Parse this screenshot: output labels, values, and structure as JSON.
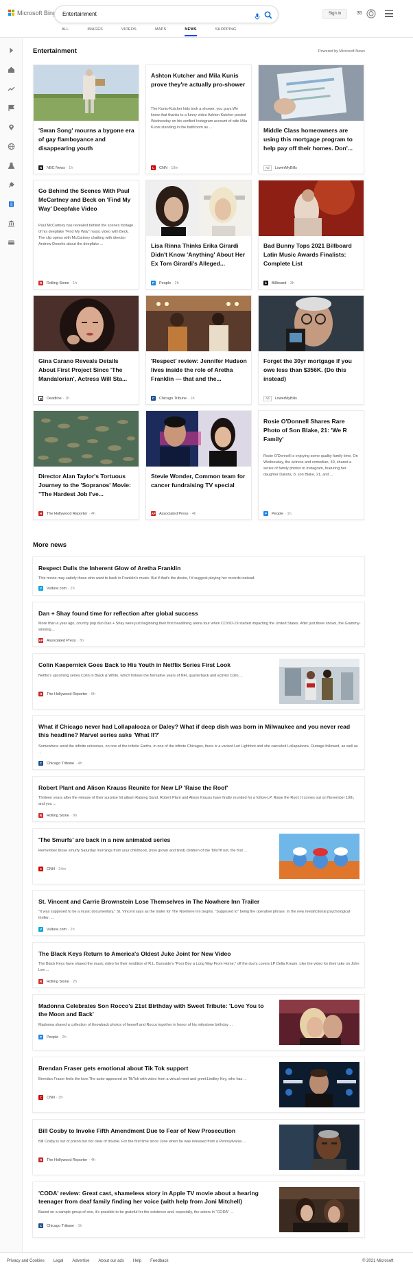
{
  "header": {
    "brand": "Microsoft Bing",
    "query": "Entertainment",
    "sign_in": "Sign in",
    "points": "35",
    "tabs": [
      {
        "label": "ALL"
      },
      {
        "label": "IMAGES"
      },
      {
        "label": "VIDEOS"
      },
      {
        "label": "MAPS"
      },
      {
        "label": "NEWS",
        "active": true
      },
      {
        "label": "SHOPPING"
      }
    ]
  },
  "section": {
    "title": "Entertainment",
    "powered": "Powered by Microsoft News"
  },
  "cards": [
    {
      "title": "'Swan Song' mourns a bygone era of gay flamboyance and disappearing youth",
      "source": "NBC News",
      "time": "1h",
      "icon": "nbc-peacock-icon"
    },
    {
      "title": "Ashton Kutcher and Mila Kunis prove they're actually pro-shower",
      "snippet": "The Kunis-Kutcher kids took a shower, you guys.We know that thanks to a funny video Ashton Kutcher posted Wednesday on his verified Instagram account of wife Mila Kunis standing in the bathroom as ...",
      "source": "CNN",
      "time": "18m",
      "icon": "cnn-icon"
    },
    {
      "title": "Middle Class homeowners are using this mortgage program to help pay off their homes. Don'...",
      "ad": "Ad",
      "source": "LowerMyBills",
      "icon": ""
    },
    {
      "title": "Go Behind the Scenes With Paul McCartney and Beck on 'Find My Way' Deepfake Video",
      "snippet": "Paul McCartney has revealed behind the scenes footage of his deepfake \"Find My Way\" music video with Beck. The clip opens with McCartney chatting with director Andrew Donoho about the deepfake ...",
      "source": "Rolling Stone",
      "time": "1h",
      "icon": "rolling-stone-icon"
    },
    {
      "title": "Lisa Rinna Thinks Erika Girardi Didn't Know 'Anything' About Her Ex Tom Girardi's Alleged...",
      "source": "People",
      "time": "2h",
      "icon": "people-icon"
    },
    {
      "title": "Bad Bunny Tops 2021 Billboard Latin Music Awards Finalists: Complete List",
      "source": "Billboard",
      "time": "3h",
      "icon": "billboard-icon"
    },
    {
      "title": "Gina Carano Reveals Details About First Project Since 'The Mandalorian', Actress Will Sta...",
      "source": "Deadline",
      "time": "1h",
      "icon": "deadline-icon"
    },
    {
      "title": "'Respect' review: Jennifer Hudson lives inside the role of Aretha Franklin — that and the...",
      "source": "Chicago Tribune",
      "time": "1h",
      "icon": "chicago-tribune-icon"
    },
    {
      "title": "Forget the 30yr mortgage if you owe less than $356K. (Do this instead)",
      "ad": "Ad",
      "source": "LowerMyBills",
      "icon": ""
    },
    {
      "title": "Director Alan Taylor's Tortuous Journey to the 'Sopranos' Movie: \"The Hardest Job I've...",
      "source": "The Hollywood Reporter",
      "time": "4h",
      "icon": "hollywood-reporter-icon"
    },
    {
      "title": "Stevie Wonder, Common team for cancer fundraising TV special",
      "source": "Associated Press",
      "time": "4h",
      "icon": "ap-icon"
    },
    {
      "title": "Rosie O'Donnell Shares Rare Photo of Son Blake, 21: 'We R Family'",
      "snippet": "Rosie O'Donnell is enjoying some quality family time. On Wednesday, the actress and comedian, 59, shared a series of family photos to Instagram, featuring her daughter Dakota, 8, son Blake, 21, and ...",
      "source": "People",
      "time": "1h",
      "icon": "people-icon"
    }
  ],
  "more_news": {
    "title": "More news",
    "items": [
      {
        "title": "Respect Dulls the Inherent Glow of Aretha Franklin",
        "snippet": "This movie may satisfy those who want to bask in Franklin's music. But if that's the desire, I'd suggest playing her records instead.",
        "source": "Vulture.com",
        "time": "2h",
        "icon": "vulture-icon"
      },
      {
        "title": "Dan + Shay found time for reflection after global success",
        "snippet": "More than a year ago, country pop duo Dan + Shay were just beginning their first headlining arena tour when COVID-19 started impacting the United States. After just three shows, the Grammy-winning ...",
        "source": "Associated Press",
        "time": "3h",
        "icon": "ap-icon"
      },
      {
        "title": "Colin Kaepernick Goes Back to His Youth in Netflix Series First Look",
        "snippet": "Netflix's upcoming series Colin in Black & White, which follows the formative years of NFL quarterback and activist Colin ...",
        "source": "The Hollywood Reporter",
        "time": "6h",
        "icon": "hollywood-reporter-icon"
      },
      {
        "title": "What if Chicago never had Lollapalooza or Daley? What if deep dish was born in Milwaukee and you never read this headline? Marvel series asks 'What If?'",
        "snippet": "Somewhere amid the infinite universes, on one of the infinite Earths, in one of the infinite Chicagos, there is a variant Lori Lightfoot and she canceled Lollapalooza. Outrage followed, as well as ...",
        "source": "Chicago Tribune",
        "time": "4h",
        "icon": "chicago-tribune-icon"
      },
      {
        "title": "Robert Plant and Alison Krauss Reunite for New LP 'Raise the Roof'",
        "snippet": "Thirteen years after the release of their surprise hit album Raising Sand, Robert Plant and Alison Krauss have finally reunited for a follow-LP, Raise the Roof. It comes out on November 19th, and you ...",
        "source": "Rolling Stone",
        "time": "9h",
        "icon": "rolling-stone-icon"
      },
      {
        "title": "'The Smurfs' are back in a new animated series",
        "snippet": "Remember those smurfy Saturday mornings from your childhood, (now grown and tired) children of the '80s?If not, the first ...",
        "source": "CNN",
        "time": "34m",
        "icon": "cnn-icon"
      },
      {
        "title": "St. Vincent and Carrie Brownstein Lose Themselves in The Nowhere Inn Trailer",
        "snippet": "\"It was supposed to be a music documentary,\" St. Vincent says as the trailer for The Nowhere Inn begins. \"Supposed to\" being the operative phrase. In the new metafictional psychological thriller, ...",
        "source": "Vulture.com",
        "time": "2h",
        "icon": "vulture-icon"
      },
      {
        "title": "The Black Keys Return to America's Oldest Juke Joint for New Video",
        "snippet": "The Black Keys have shared the music video for their rendition of R.L. Burnside's \"Poor Boy a Long Way From Home,\" off the duo's covers LP Delta Kream. Like the video for their take on John Lee ...",
        "source": "Rolling Stone",
        "time": "2h",
        "icon": "rolling-stone-icon"
      },
      {
        "title": "Madonna Celebrates Son Rocco's 21st Birthday with Sweet Tribute: 'Love You to the Moon and Back'",
        "snippet": "Madonna shared a collection of throwback photos of herself and Rocco together in honor of his milestone birthday ...",
        "source": "People",
        "time": "2h",
        "icon": "people-icon"
      },
      {
        "title": "Brendan Fraser gets emotional about Tik Tok support",
        "snippet": "Brendan Fraser feels the love.The actor appeared on TikTok with video from a virtual meet and greet.Lindley Key, who has ...",
        "source": "CNN",
        "time": "3h",
        "icon": "cnn-icon"
      },
      {
        "title": "Bill Cosby to Invoke Fifth Amendment Due to Fear of New Prosecution",
        "snippet": "Bill Cosby is out of prison but not clear of trouble. For the first time since June when he was released from a Pennsylvania ...",
        "source": "The Hollywood Reporter",
        "time": "4h",
        "icon": "hollywood-reporter-icon"
      },
      {
        "title": "'CODA' review: Great cast, shameless story in Apple TV movie about a hearing teenager from deaf family finding her voice (with help from Joni Mitchell)",
        "snippet": "Based on a sample group of one, it's possible to be grateful for the existence and, especially, the actors in \"CODA\" ...",
        "source": "Chicago Tribune",
        "time": "1h",
        "icon": "chicago-tribune-icon"
      }
    ]
  },
  "footer": {
    "links": [
      "Privacy and Cookies",
      "Legal",
      "Advertise",
      "About our ads",
      "Help",
      "Feedback"
    ],
    "copyright": "© 2021 Microsoft"
  },
  "colors": {
    "accent": "#174ae4",
    "bing_blue": "#0c6dd4"
  }
}
